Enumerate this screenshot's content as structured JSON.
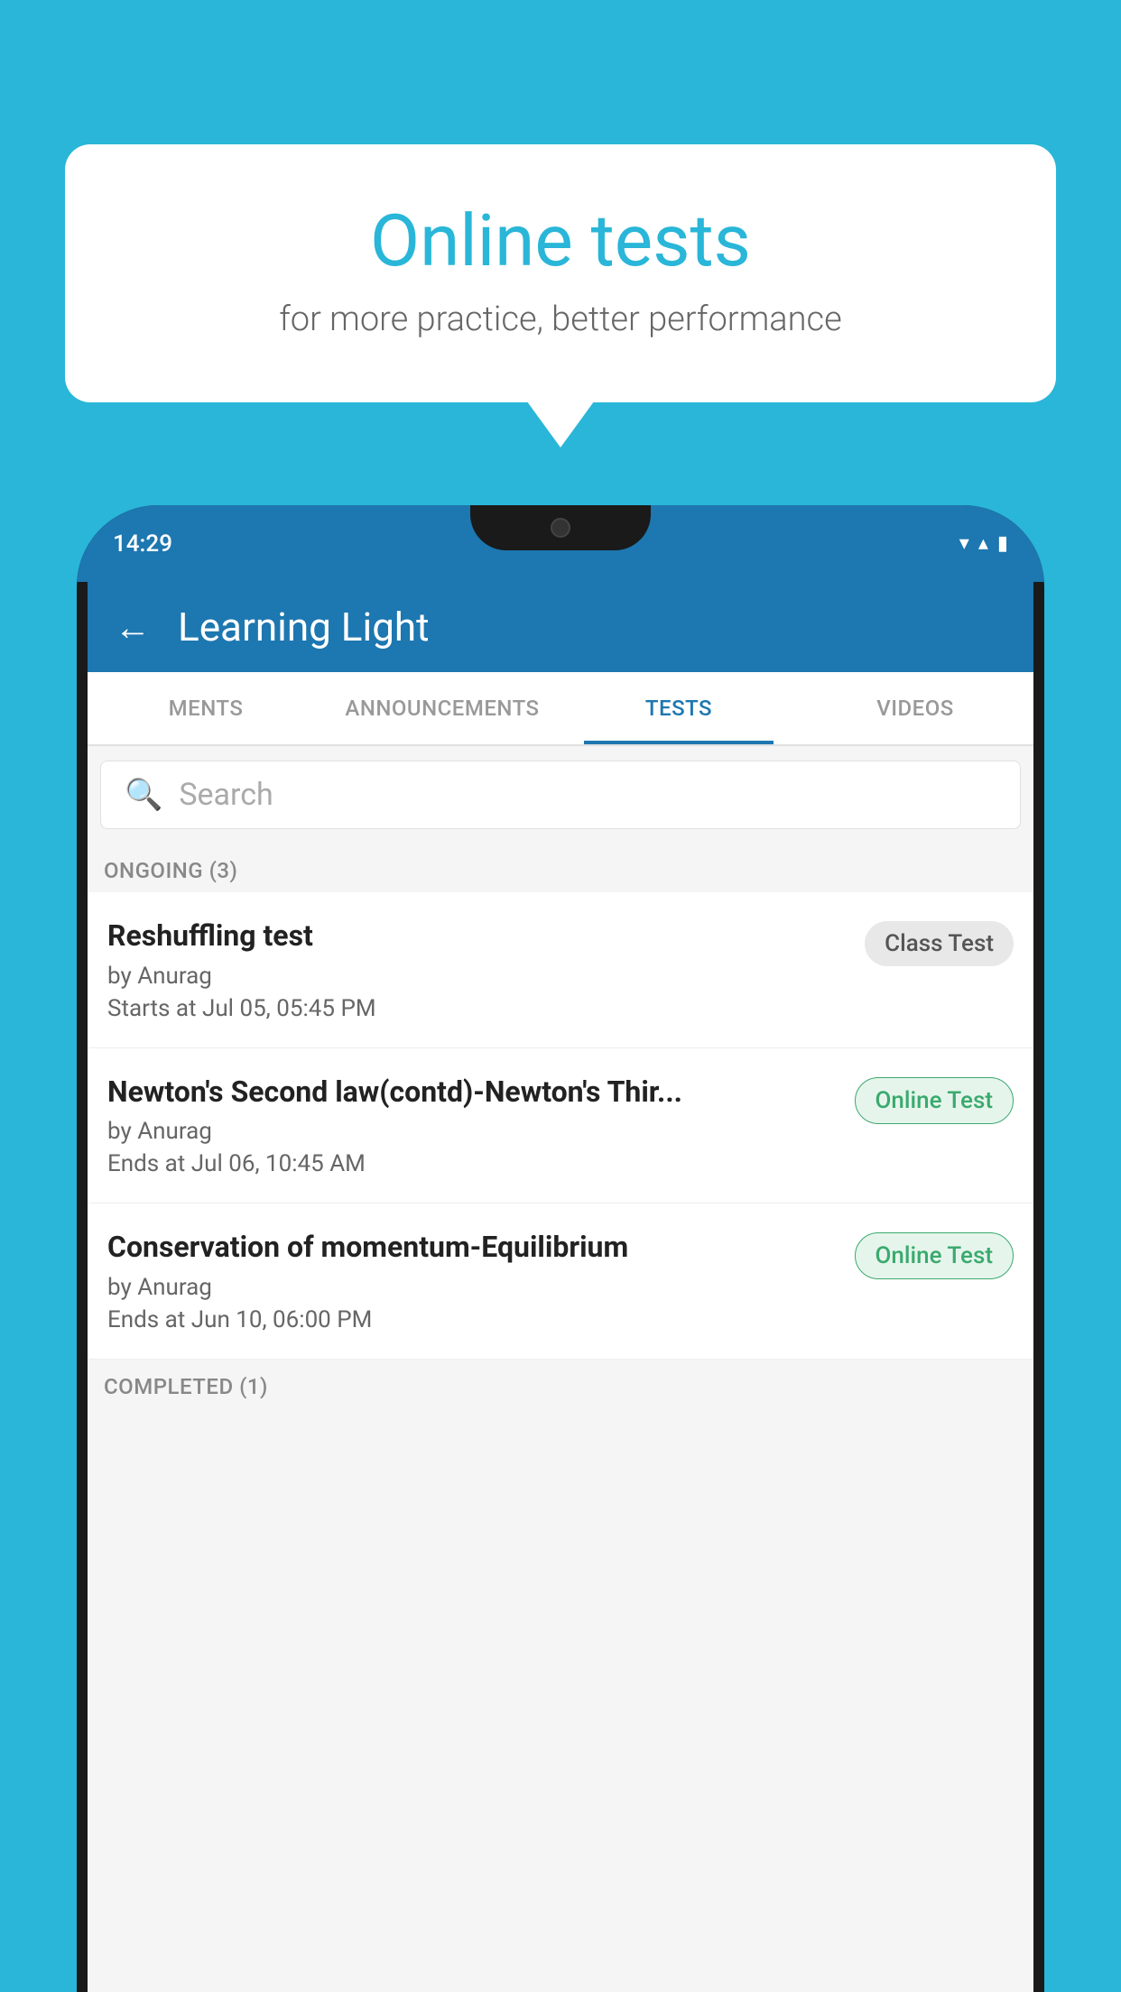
{
  "background": {
    "color": "#29b6d8"
  },
  "speech_bubble": {
    "title": "Online tests",
    "subtitle": "for more practice, better performance"
  },
  "phone": {
    "status_bar": {
      "time": "14:29",
      "wifi_icon": "▼",
      "signal_icon": "▲",
      "battery_icon": "▮"
    },
    "app_bar": {
      "back_label": "←",
      "title": "Learning Light"
    },
    "tabs": [
      {
        "label": "MENTS",
        "active": false
      },
      {
        "label": "ANNOUNCEMENTS",
        "active": false
      },
      {
        "label": "TESTS",
        "active": true
      },
      {
        "label": "VIDEOS",
        "active": false
      }
    ],
    "search": {
      "placeholder": "Search"
    },
    "sections": [
      {
        "label": "ONGOING (3)",
        "items": [
          {
            "title": "Reshuffling test",
            "author": "by Anurag",
            "time": "Starts at  Jul 05, 05:45 PM",
            "badge": "Class Test",
            "badge_type": "class"
          },
          {
            "title": "Newton's Second law(contd)-Newton's Thir...",
            "author": "by Anurag",
            "time": "Ends at  Jul 06, 10:45 AM",
            "badge": "Online Test",
            "badge_type": "online"
          },
          {
            "title": "Conservation of momentum-Equilibrium",
            "author": "by Anurag",
            "time": "Ends at  Jun 10, 06:00 PM",
            "badge": "Online Test",
            "badge_type": "online"
          }
        ]
      },
      {
        "label": "COMPLETED (1)",
        "items": []
      }
    ]
  }
}
